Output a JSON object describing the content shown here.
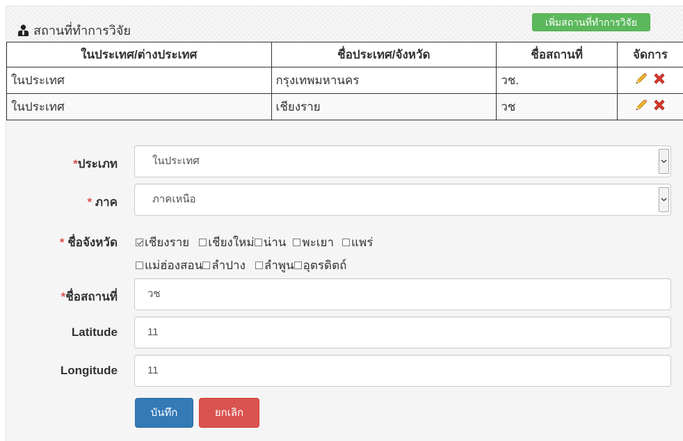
{
  "header": {
    "title": "สถานที่ทำการวิจัย",
    "add_button": "เพิ่มสถานที่ทำการวิจัย"
  },
  "table": {
    "columns": [
      "ในประเทศ/ต่างประเทศ",
      "ชื่อประเทศ/จังหวัด",
      "ชื่อสถานที่",
      "จัดการ"
    ],
    "rows": [
      [
        "ในประเทศ",
        "กรุงเทพมหานคร",
        "วช."
      ],
      [
        "ในประเทศ",
        "เชียงราย",
        "วช"
      ]
    ]
  },
  "form": {
    "type": {
      "label": "ประเภท",
      "value": "ในประเทศ"
    },
    "region": {
      "label": " ภาค",
      "value": "ภาคเหนือ"
    },
    "province": {
      "label": " ชื่อจังหวัด",
      "options": [
        {
          "label": "เชียงราย",
          "checked": true
        },
        {
          "label": "เชียงใหม่",
          "checked": false
        },
        {
          "label": "น่าน",
          "checked": false
        },
        {
          "label": "พะเยา",
          "checked": false
        },
        {
          "label": "แพร่",
          "checked": false
        },
        {
          "label": "แม่ฮ่องสอน",
          "checked": false
        },
        {
          "label": "ลำปาง",
          "checked": false
        },
        {
          "label": "ลำพูน",
          "checked": false
        },
        {
          "label": "อุตรดิตถ์",
          "checked": false
        }
      ]
    },
    "place": {
      "label": "ชื่อสถานที่",
      "value": "วช"
    },
    "latitude": {
      "label": "Latitude",
      "value": "11"
    },
    "longitude": {
      "label": "Longitude",
      "value": "11"
    },
    "required_mark": "*",
    "save_button": "บันทึก",
    "cancel_button": "ยกเลิก"
  },
  "colors": {
    "add_button": "#5cb85c",
    "save_button": "#337ab7",
    "cancel_button": "#d9534f",
    "required": "#d9534f"
  },
  "icons": {
    "header": "user-tie-icon",
    "edit": "pencil-icon",
    "delete": "red-x-icon",
    "select": "chevron-down-icon"
  }
}
